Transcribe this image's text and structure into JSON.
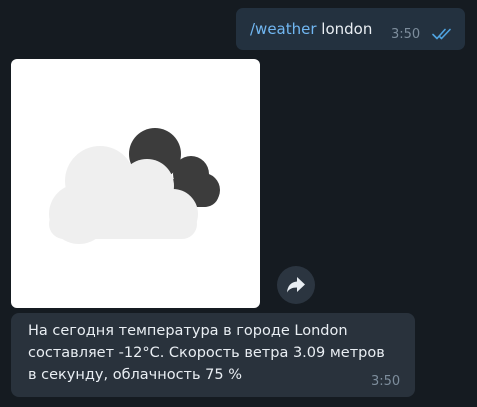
{
  "outgoing": {
    "command": "/weather",
    "argument": " london",
    "time": "3:50",
    "status_icon": "double-check-icon"
  },
  "photo": {
    "icon": "cloudy-weather-icon",
    "colors": {
      "background": "#ffffff",
      "light_cloud": "#efefef",
      "dark_cloud": "#3c3c3c"
    }
  },
  "forward": {
    "icon": "forward-arrow-icon"
  },
  "incoming": {
    "text": "На сегодня температура в городе London составляет -12°C. Скорость ветра 3.09 метров в секунду, облачность 75 %",
    "time": "3:50"
  },
  "colors": {
    "chat_background": "#151b21",
    "incoming_bubble": "#29323c",
    "outgoing_bubble": "#23313f",
    "link": "#71b7f2",
    "text": "#e9eef3",
    "time": "#7d8d9c"
  }
}
